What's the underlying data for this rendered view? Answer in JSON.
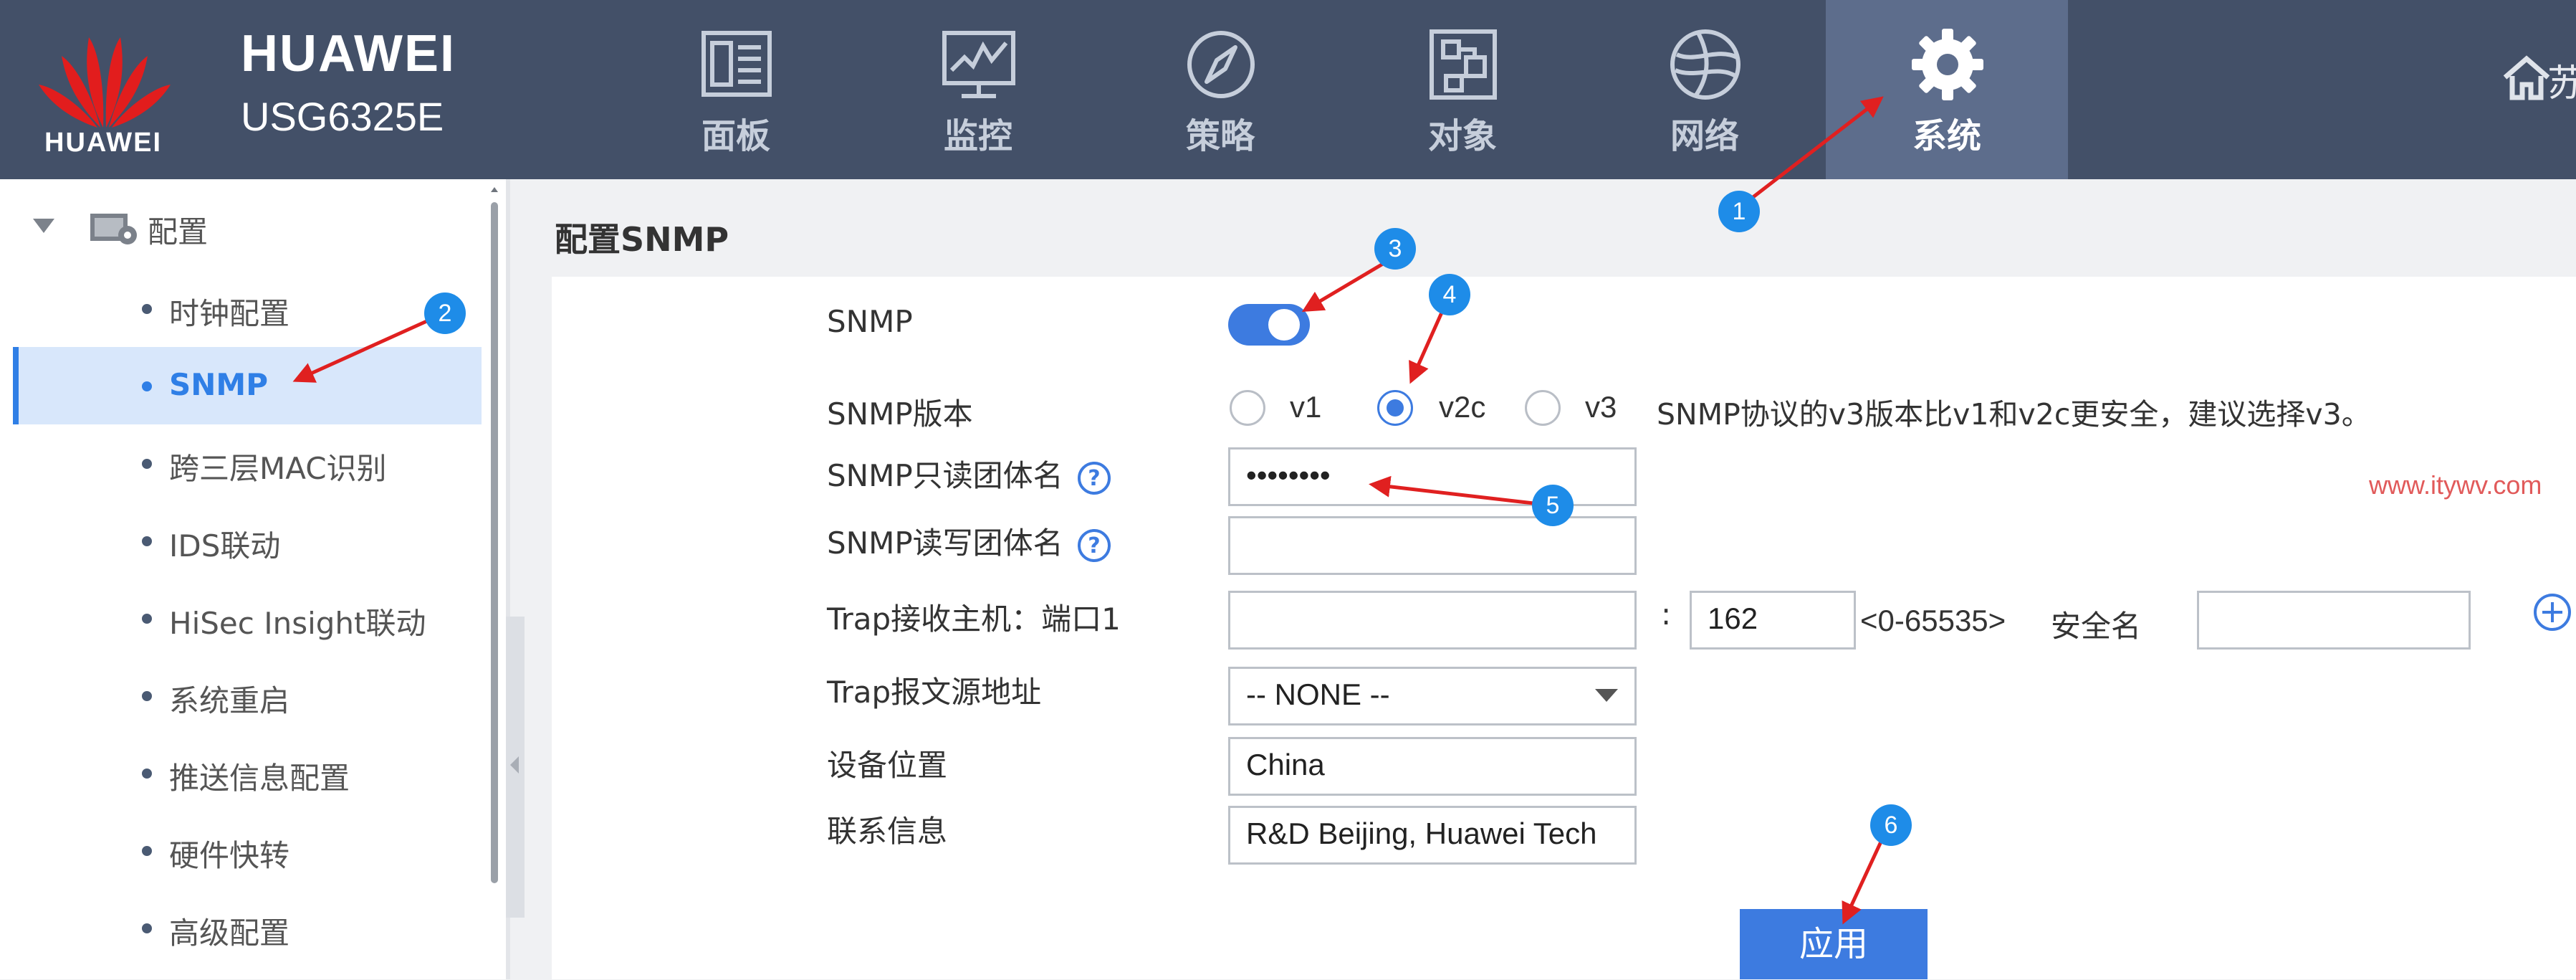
{
  "brand": {
    "logo_text": "HUAWEI",
    "name": "HUAWEI",
    "model": "USG6325E",
    "logo_color": "#e21d1d"
  },
  "nav": {
    "tabs": [
      {
        "label": "面板",
        "icon": "dashboard-icon"
      },
      {
        "label": "监控",
        "icon": "monitor-icon"
      },
      {
        "label": "策略",
        "icon": "compass-icon"
      },
      {
        "label": "对象",
        "icon": "object-icon"
      },
      {
        "label": "网络",
        "icon": "globe-icon"
      },
      {
        "label": "系统",
        "icon": "gear-icon",
        "active": true
      }
    ],
    "user_label_clipped": "苏",
    "header_bg": "#435068",
    "active_bg": "#5d6d8c"
  },
  "sidebar": {
    "root_label": "配置",
    "items": [
      {
        "label": "时钟配置"
      },
      {
        "label": "SNMP",
        "active": true
      },
      {
        "label": "跨三层MAC识别"
      },
      {
        "label": "IDS联动"
      },
      {
        "label": "HiSec Insight联动"
      },
      {
        "label": "系统重启"
      },
      {
        "label": "推送信息配置"
      },
      {
        "label": "硬件快转"
      },
      {
        "label": "高级配置"
      }
    ],
    "active_color": "#2f7fe6"
  },
  "panel": {
    "title": "配置SNMP",
    "snmp_label": "SNMP",
    "snmp_enabled": true,
    "version_label": "SNMP版本",
    "versions": [
      {
        "label": "v1",
        "checked": false
      },
      {
        "label": "v2c",
        "checked": true
      },
      {
        "label": "v3",
        "checked": false
      }
    ],
    "version_hint": "SNMP协议的v3版本比v1和v2c更安全，建议选择v3。",
    "ro_community_label": "SNMP只读团体名",
    "ro_community_value": "••••••••",
    "rw_community_label": "SNMP读写团体名",
    "rw_community_value": "",
    "trap_host_label": "Trap接收主机：端口1",
    "trap_host_value": "",
    "colon": ":",
    "trap_port_value": "162",
    "port_range": "<0-65535>",
    "security_name_label": "安全名",
    "security_name_value": "",
    "trap_source_label": "Trap报文源地址",
    "trap_source_value": "-- NONE --",
    "location_label": "设备位置",
    "location_value": "China",
    "contact_label": "联系信息",
    "contact_value": "R&D Beijing, Huawei Tech",
    "apply_label": "应用",
    "accent": "#3d7be0"
  },
  "watermark": "www.itywv.com",
  "annotations": {
    "badges": [
      "1",
      "2",
      "3",
      "4",
      "5",
      "6"
    ],
    "badge_color": "#1e8ce8",
    "arrow_color": "#e02020"
  }
}
